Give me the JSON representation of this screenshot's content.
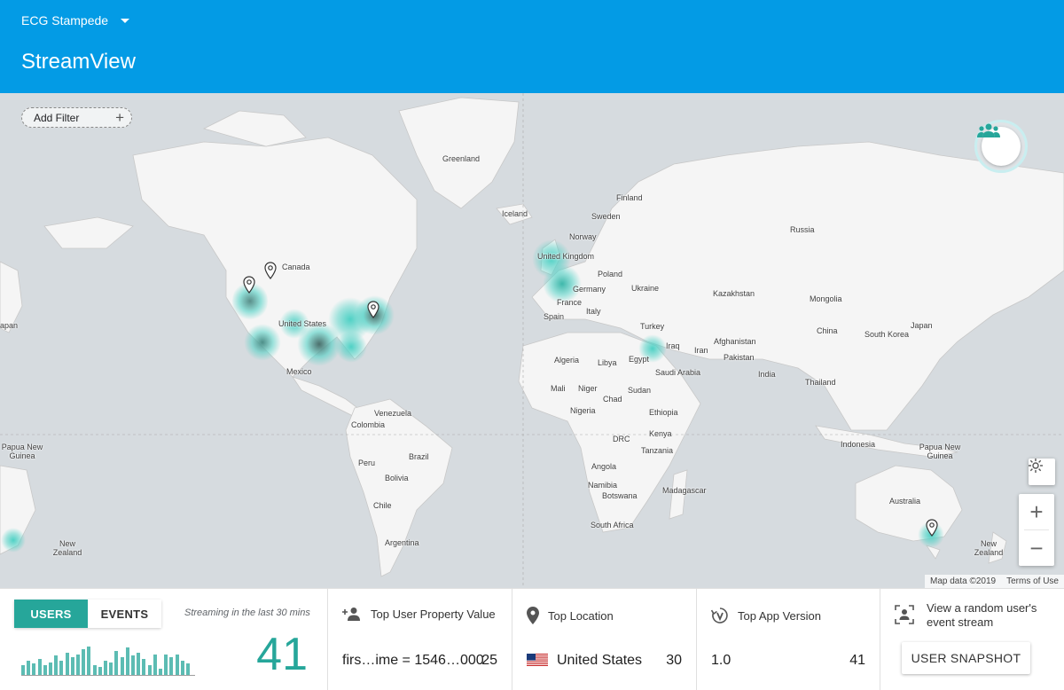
{
  "header": {
    "project_name": "ECG Stampede",
    "page_title": "StreamView"
  },
  "map": {
    "add_filter_label": "Add Filter",
    "attribution": {
      "map_data": "Map data ©2019",
      "terms": "Terms of Use"
    },
    "labels": [
      "Greenland",
      "Iceland",
      "Finland",
      "Sweden",
      "Norway",
      "Russia",
      "United Kingdom",
      "Poland",
      "Germany",
      "Ukraine",
      "France",
      "Italy",
      "Spain",
      "Kazakhstan",
      "Mongolia",
      "Turkey",
      "China",
      "South Korea",
      "Japan",
      "Iraq",
      "Iran",
      "Afghanistan",
      "Pakistan",
      "India",
      "Thailand",
      "Algeria",
      "Libya",
      "Egypt",
      "Saudi Arabia",
      "Mali",
      "Niger",
      "Sudan",
      "Chad",
      "Nigeria",
      "Ethiopia",
      "DRC",
      "Kenya",
      "Tanzania",
      "Angola",
      "Namibia",
      "Botswana",
      "Madagascar",
      "South Africa",
      "Canada",
      "United States",
      "Mexico",
      "Venezuela",
      "Colombia",
      "Peru",
      "Brazil",
      "Bolivia",
      "Chile",
      "Argentina",
      "Indonesia",
      "Papua New Guinea",
      "Australia",
      "New Zealand",
      "apan"
    ],
    "icons": {
      "users": "group-icon",
      "style": "sun-icon",
      "zoom_in": "+",
      "zoom_out": "−"
    }
  },
  "bottom": {
    "tabs": {
      "users": "USERS",
      "events": "EVENTS",
      "selected": "USERS"
    },
    "streaming_text": "Streaming in the last 30 mins",
    "user_count": "41",
    "activity_bars": [
      0.3,
      0.45,
      0.35,
      0.5,
      0.3,
      0.4,
      0.6,
      0.45,
      0.7,
      0.55,
      0.65,
      0.8,
      0.9,
      0.3,
      0.25,
      0.45,
      0.4,
      0.75,
      0.55,
      0.85,
      0.6,
      0.7,
      0.5,
      0.3,
      0.65,
      0.2,
      0.65,
      0.55,
      0.65,
      0.45,
      0.35
    ],
    "top_user_property": {
      "title": "Top User Property Value",
      "value": "firs…ime = 1546…000",
      "count": "25"
    },
    "top_location": {
      "title": "Top Location",
      "value": "United States",
      "count": "30"
    },
    "top_app_version": {
      "title": "Top App Version",
      "value": "1.0",
      "count": "41"
    },
    "snapshot": {
      "text": "View a random user's event stream",
      "button_label": "USER SNAPSHOT"
    }
  },
  "colors": {
    "header": "#039be5",
    "accent": "#26a69a",
    "heat": "#4fd1c5"
  }
}
